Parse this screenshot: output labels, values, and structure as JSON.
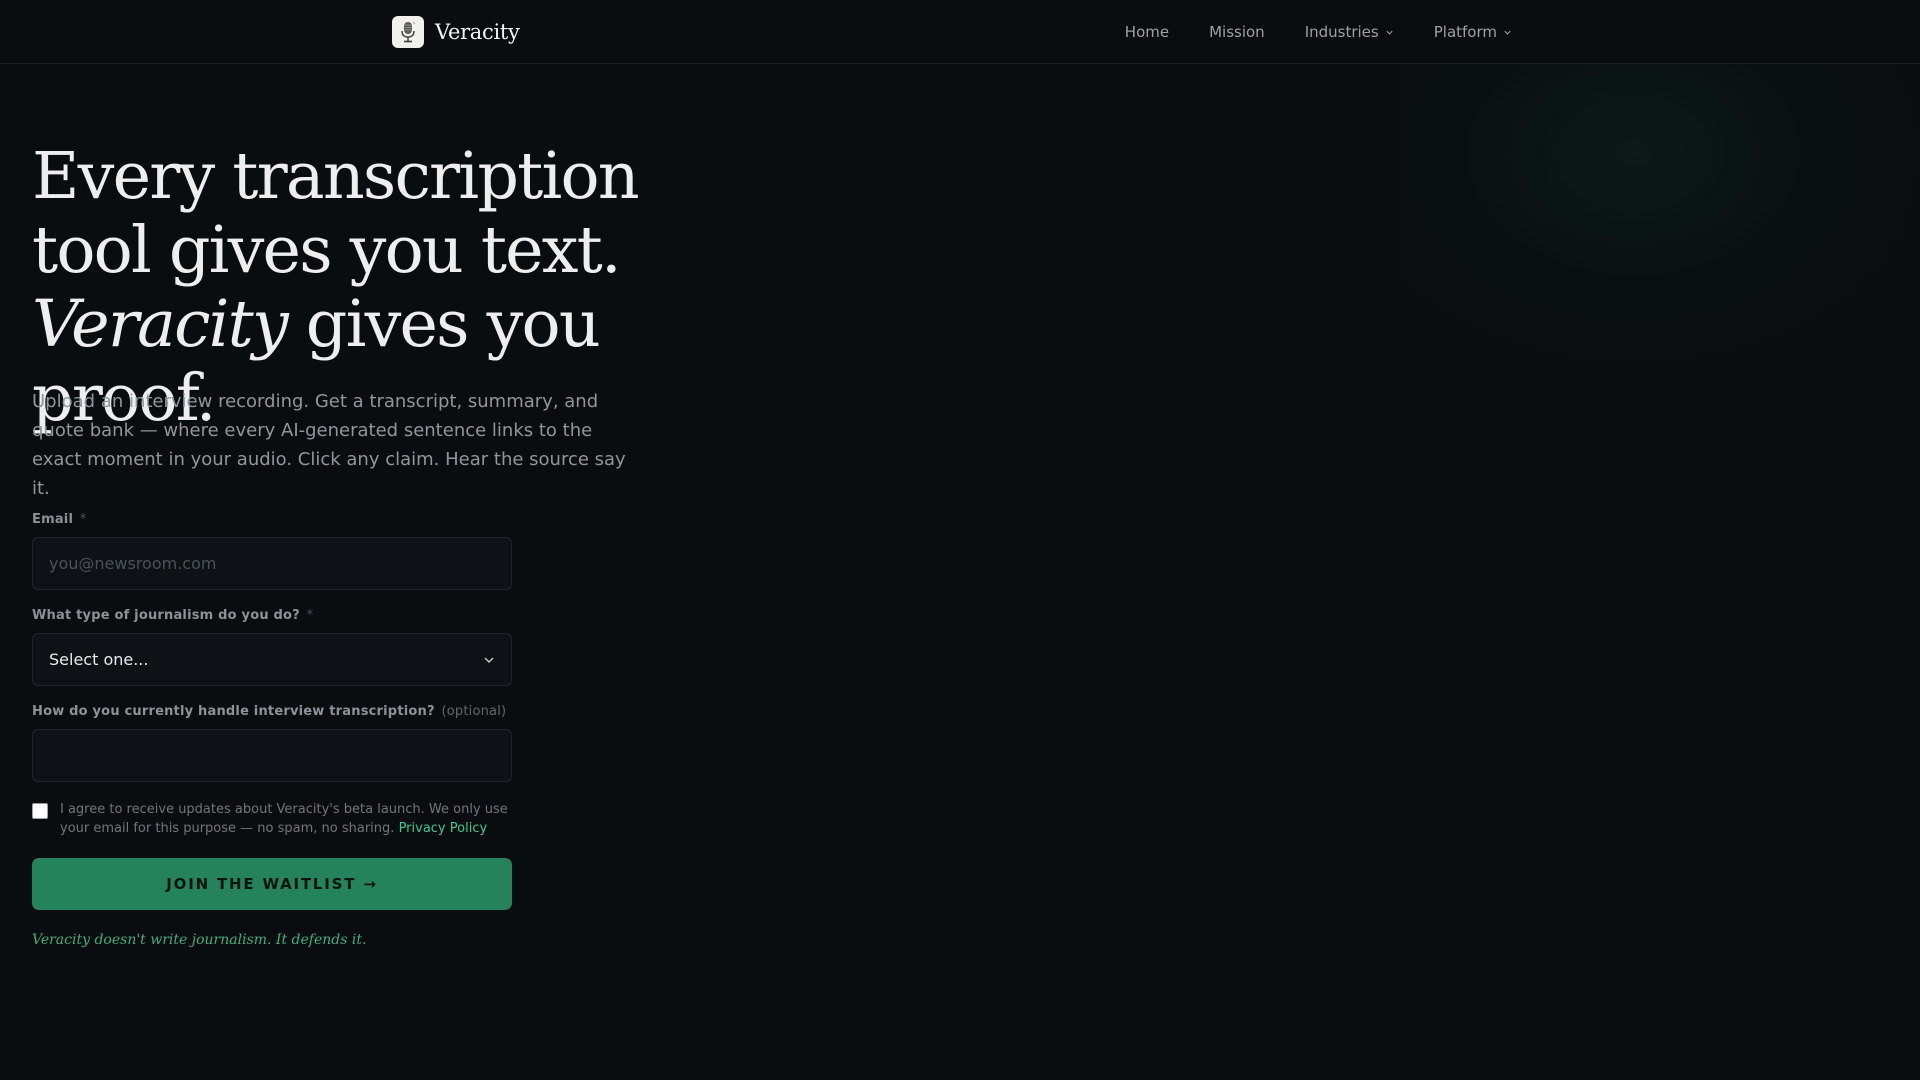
{
  "brand": {
    "name": "Veracity",
    "logo_icon": "microphone-icon"
  },
  "nav": {
    "items": [
      {
        "label": "Home"
      },
      {
        "label": "Mission"
      },
      {
        "label": "Industries",
        "icon": "chevron-down-icon"
      },
      {
        "label": "Platform",
        "icon": "chevron-down-icon"
      }
    ]
  },
  "hero": {
    "title_part1": "Every transcription tool gives you text. ",
    "title_emphasis": "Veracity",
    "title_part2": " gives you proof.",
    "subtitle": "Upload an interview recording. Get a transcript, summary, and quote bank — where every AI-generated sentence links to the exact moment in your audio. Click any claim. Hear the source say it."
  },
  "form": {
    "email": {
      "label": "Email",
      "required_mark": "*",
      "placeholder": "you@newsroom.com",
      "value": ""
    },
    "journalism_type": {
      "label": "What type of journalism do you do?",
      "required_mark": "*",
      "value": "Select one..."
    },
    "transcription": {
      "label": "How do you currently handle interview transcription?",
      "optional_note": "(optional)",
      "value": ""
    },
    "consent": {
      "checked": false,
      "text": "I agree to receive updates about Veracity's beta launch. We only use your email for this purpose — no spam, no sharing.",
      "link_text": "Privacy Policy"
    },
    "submit_label": "JOIN THE WAITLIST →",
    "tagline": "Veracity doesn't write journalism. It defends it."
  },
  "colors": {
    "background": "#0a0d10",
    "accent": "#25835c",
    "link": "#3ec98d"
  }
}
